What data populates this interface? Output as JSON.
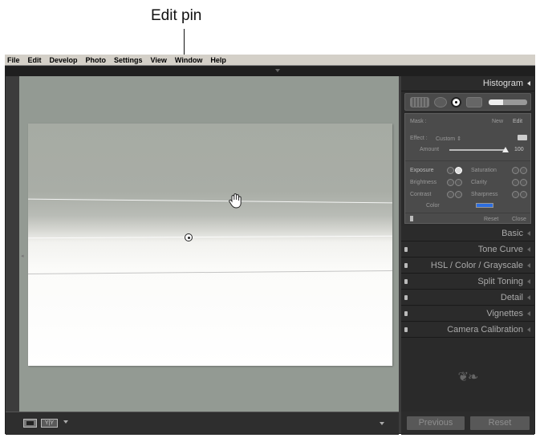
{
  "callout": {
    "label": "Edit pin"
  },
  "menu": [
    "File",
    "Edit",
    "Develop",
    "Photo",
    "Settings",
    "View",
    "Window",
    "Help"
  ],
  "panel": {
    "histogram": "Histogram",
    "mask": {
      "label": "Mask :",
      "new": "New",
      "edit": "Edit"
    },
    "effect": {
      "label": "Effect :",
      "preset": "Custom",
      "amount_label": "Amount",
      "amount_value": "100",
      "amount_fraction": 1.0
    },
    "sliders": [
      {
        "label": "Exposure"
      },
      {
        "label": "Saturation"
      },
      {
        "label": "Brightness"
      },
      {
        "label": "Clarity"
      },
      {
        "label": "Contrast"
      },
      {
        "label": "Sharpness"
      }
    ],
    "color_label": "Color",
    "reset": "Reset",
    "close": "Close",
    "sections": [
      "Basic",
      "Tone Curve",
      "HSL / Color / Grayscale",
      "Split Toning",
      "Detail",
      "Vignettes",
      "Camera Calibration"
    ],
    "previous": "Previous",
    "reset_button": "Reset"
  },
  "colors": {
    "panel_bg": "#2a2a2a",
    "canvas_bg": "#939a93",
    "color_swatch": "#2d6ee0"
  }
}
